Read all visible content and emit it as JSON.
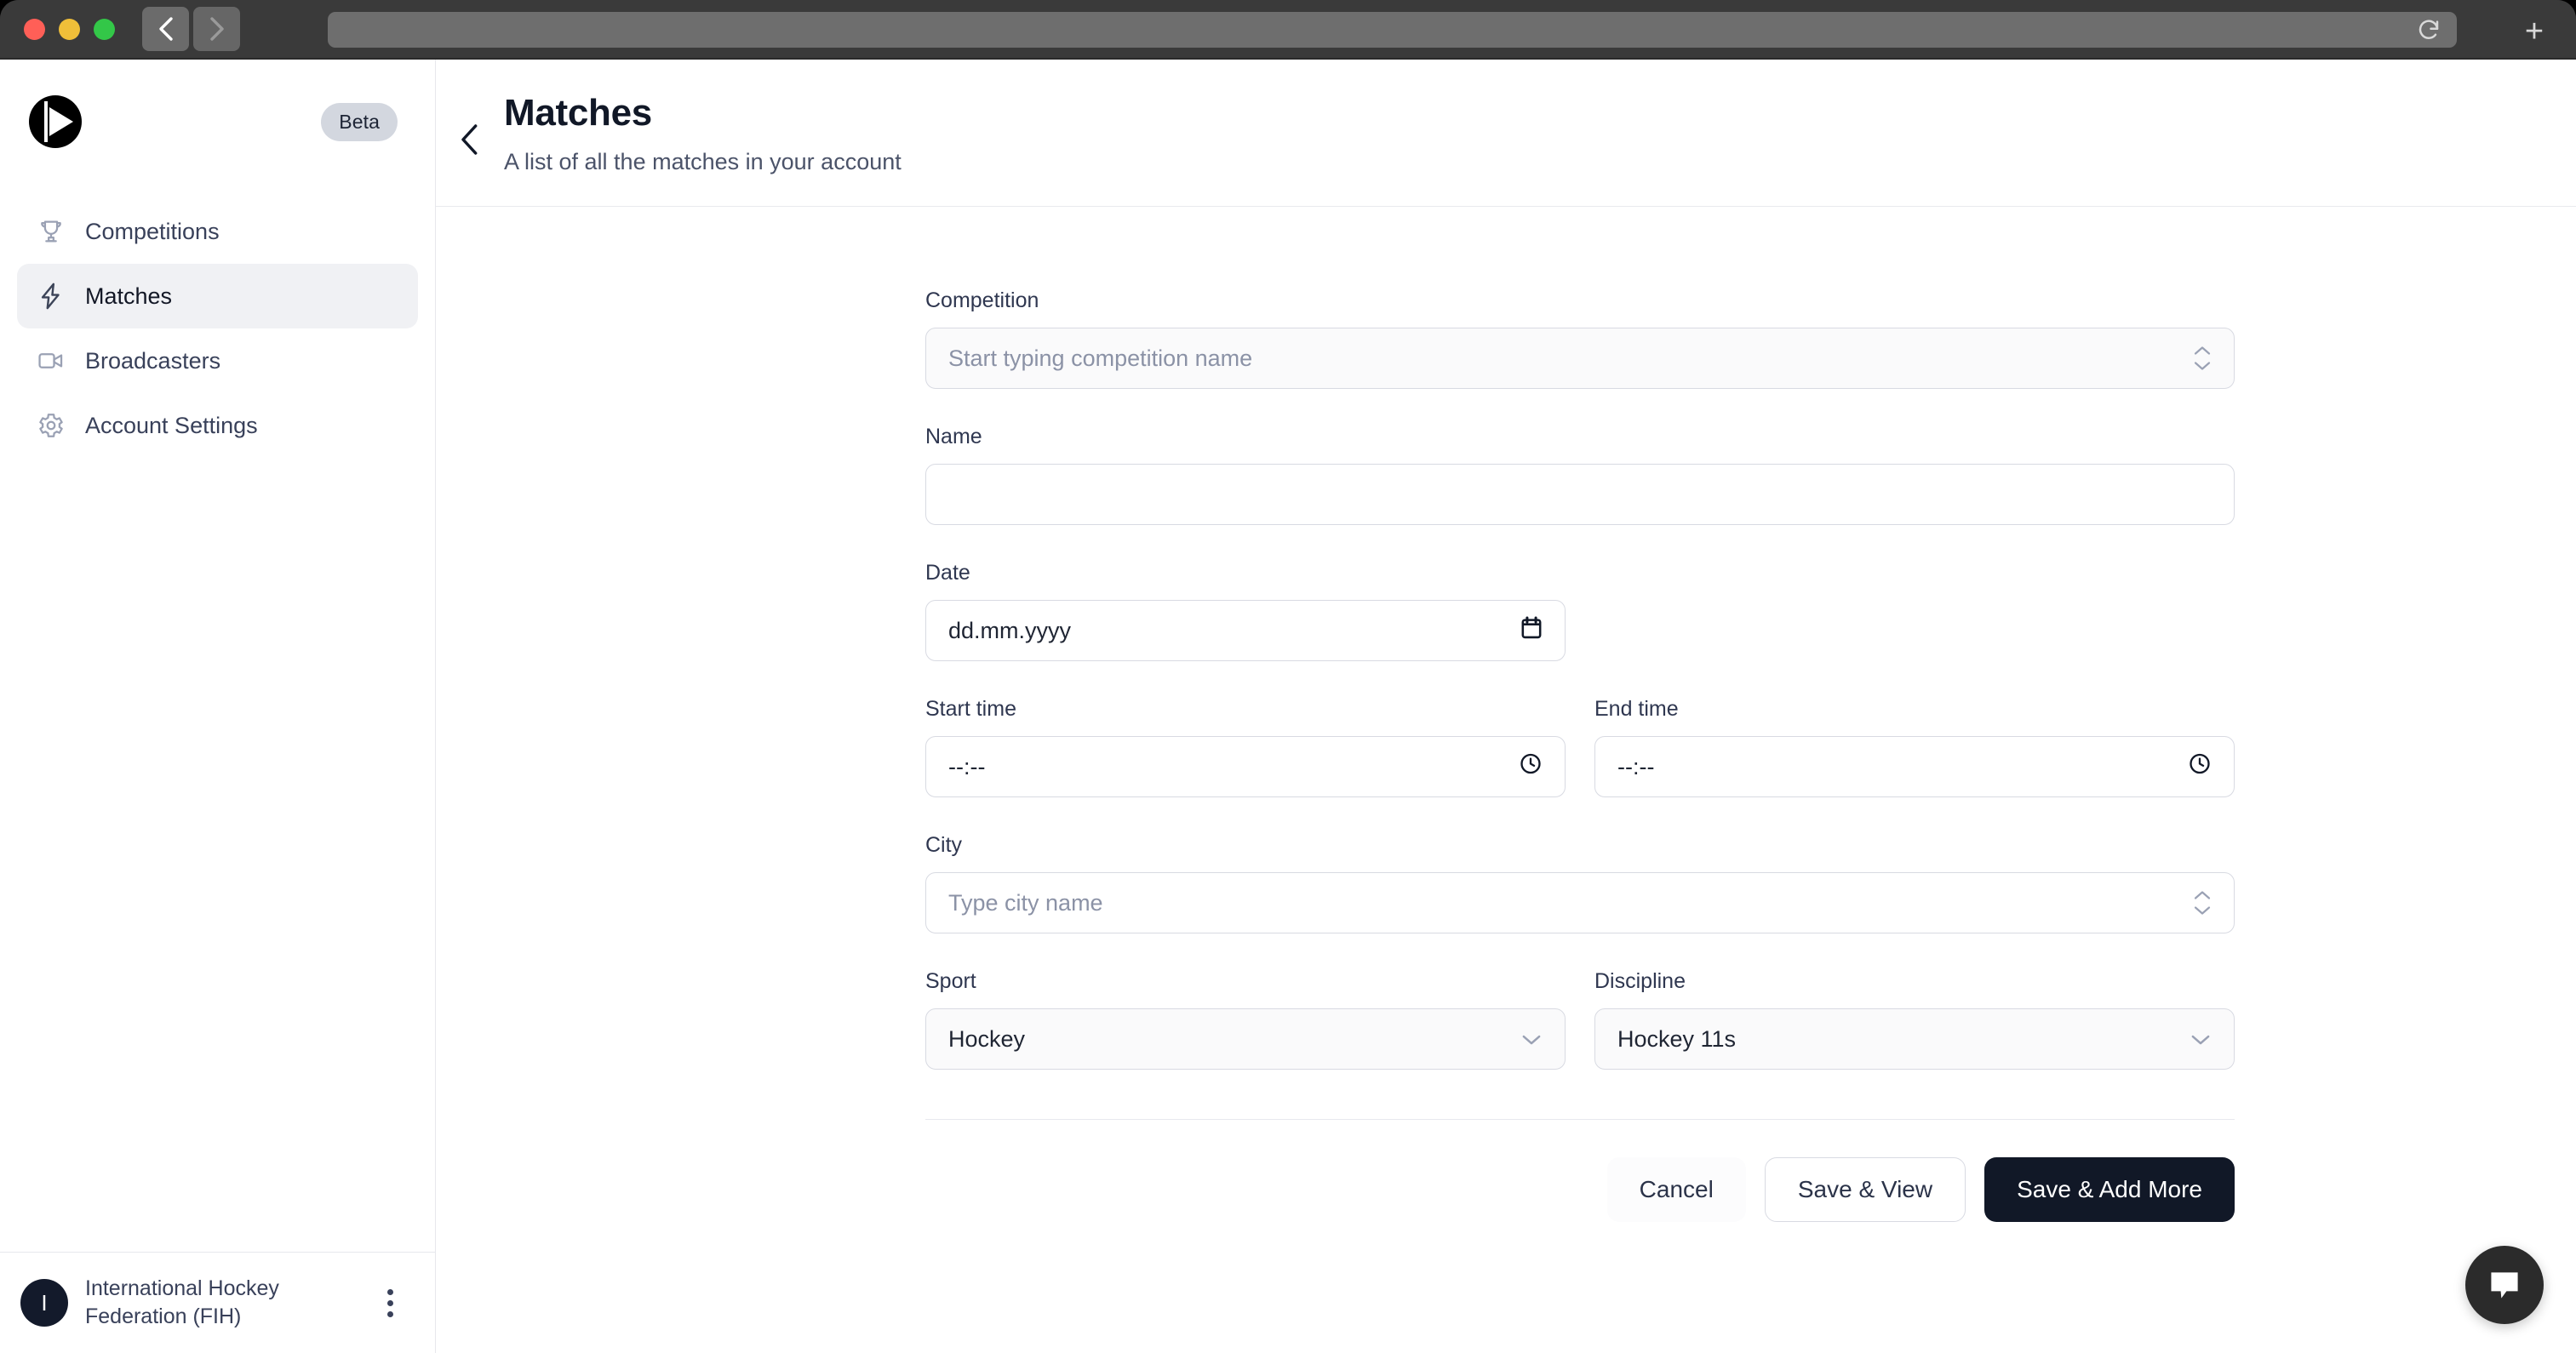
{
  "browser": {
    "back_icon": "chevron-left-icon",
    "forward_icon": "chevron-right-icon",
    "reload_icon": "reload-icon",
    "new_tab_label": "+",
    "address_value": ""
  },
  "sidebar": {
    "logo_icon": "play-circle-logo",
    "badge": "Beta",
    "items": [
      {
        "label": "Competitions",
        "icon": "trophy-icon",
        "active": false
      },
      {
        "label": "Matches",
        "icon": "bolt-icon",
        "active": true
      },
      {
        "label": "Broadcasters",
        "icon": "video-camera-icon",
        "active": false
      },
      {
        "label": "Account Settings",
        "icon": "gear-icon",
        "active": false
      }
    ],
    "account": {
      "avatar_letter": "I",
      "org_name": "International Hockey Federation (FIH)",
      "menu_icon": "kebab-menu-icon"
    }
  },
  "header": {
    "back_icon": "chevron-left-icon",
    "title": "Matches",
    "subtitle": "A list of all the matches in your account"
  },
  "form": {
    "competition": {
      "label": "Competition",
      "placeholder": "Start typing competition name",
      "value": "",
      "icon": "chevron-up-down-icon"
    },
    "name": {
      "label": "Name",
      "placeholder": "",
      "value": ""
    },
    "date": {
      "label": "Date",
      "value": "dd.mm.yyyy",
      "icon": "calendar-icon"
    },
    "start_time": {
      "label": "Start time",
      "value": "--:--",
      "icon": "clock-icon"
    },
    "end_time": {
      "label": "End time",
      "value": "--:--",
      "icon": "clock-icon"
    },
    "city": {
      "label": "City",
      "placeholder": "Type city name",
      "value": "",
      "icon": "chevron-up-down-icon"
    },
    "sport": {
      "label": "Sport",
      "value": "Hockey",
      "icon": "chevron-down-icon"
    },
    "discipline": {
      "label": "Discipline",
      "value": "Hockey 11s",
      "icon": "chevron-down-icon"
    }
  },
  "actions": {
    "cancel": "Cancel",
    "save_view": "Save & View",
    "save_add_more": "Save & Add More"
  },
  "chat": {
    "icon": "chat-bubble-icon"
  },
  "colors": {
    "primary": "#111827",
    "active_nav_bg": "#f0f1f4",
    "badge_bg": "#d3d7df",
    "border": "#d8dae2"
  }
}
